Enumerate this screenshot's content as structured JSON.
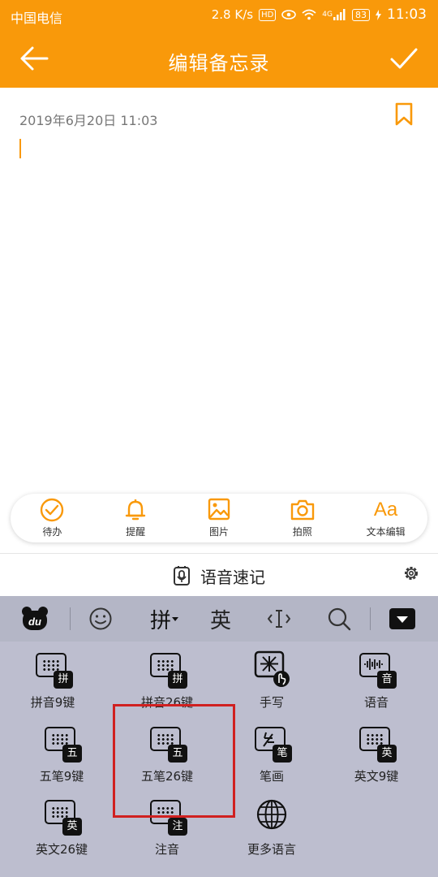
{
  "status_bar": {
    "carrier": "中国电信",
    "speed": "2.8 K/s",
    "hd": "HD",
    "network": "4G",
    "battery": "83",
    "time": "11:03"
  },
  "header": {
    "title": "编辑备忘录"
  },
  "note": {
    "date": "2019年6月20日 11:03"
  },
  "actions": [
    {
      "label": "待办",
      "icon": "check-circle-icon"
    },
    {
      "label": "提醒",
      "icon": "bell-icon"
    },
    {
      "label": "图片",
      "icon": "image-icon"
    },
    {
      "label": "拍照",
      "icon": "camera-icon"
    },
    {
      "label": "文本编辑",
      "icon": "text-format-icon",
      "glyph": "Aa"
    }
  ],
  "voice_note": {
    "label": "语音速记"
  },
  "keyboard": {
    "toolbar": {
      "pinyin": "拼",
      "english": "英"
    },
    "input_methods": [
      {
        "label": "拼音9键",
        "badge": "拼"
      },
      {
        "label": "拼音26键",
        "badge": "拼"
      },
      {
        "label": "手写"
      },
      {
        "label": "语音",
        "badge": "音"
      },
      {
        "label": "五笔9键",
        "badge": "五"
      },
      {
        "label": "五笔26键",
        "badge": "五"
      },
      {
        "label": "笔画",
        "badge": "笔"
      },
      {
        "label": "英文9键",
        "badge": "英"
      },
      {
        "label": "英文26键",
        "badge": "英"
      },
      {
        "label": "注音",
        "badge": "注"
      },
      {
        "label": "更多语言"
      }
    ]
  },
  "colors": {
    "accent": "#F9990A",
    "highlight_box": "#D02020",
    "keyboard_bg": "#BDBECF"
  }
}
